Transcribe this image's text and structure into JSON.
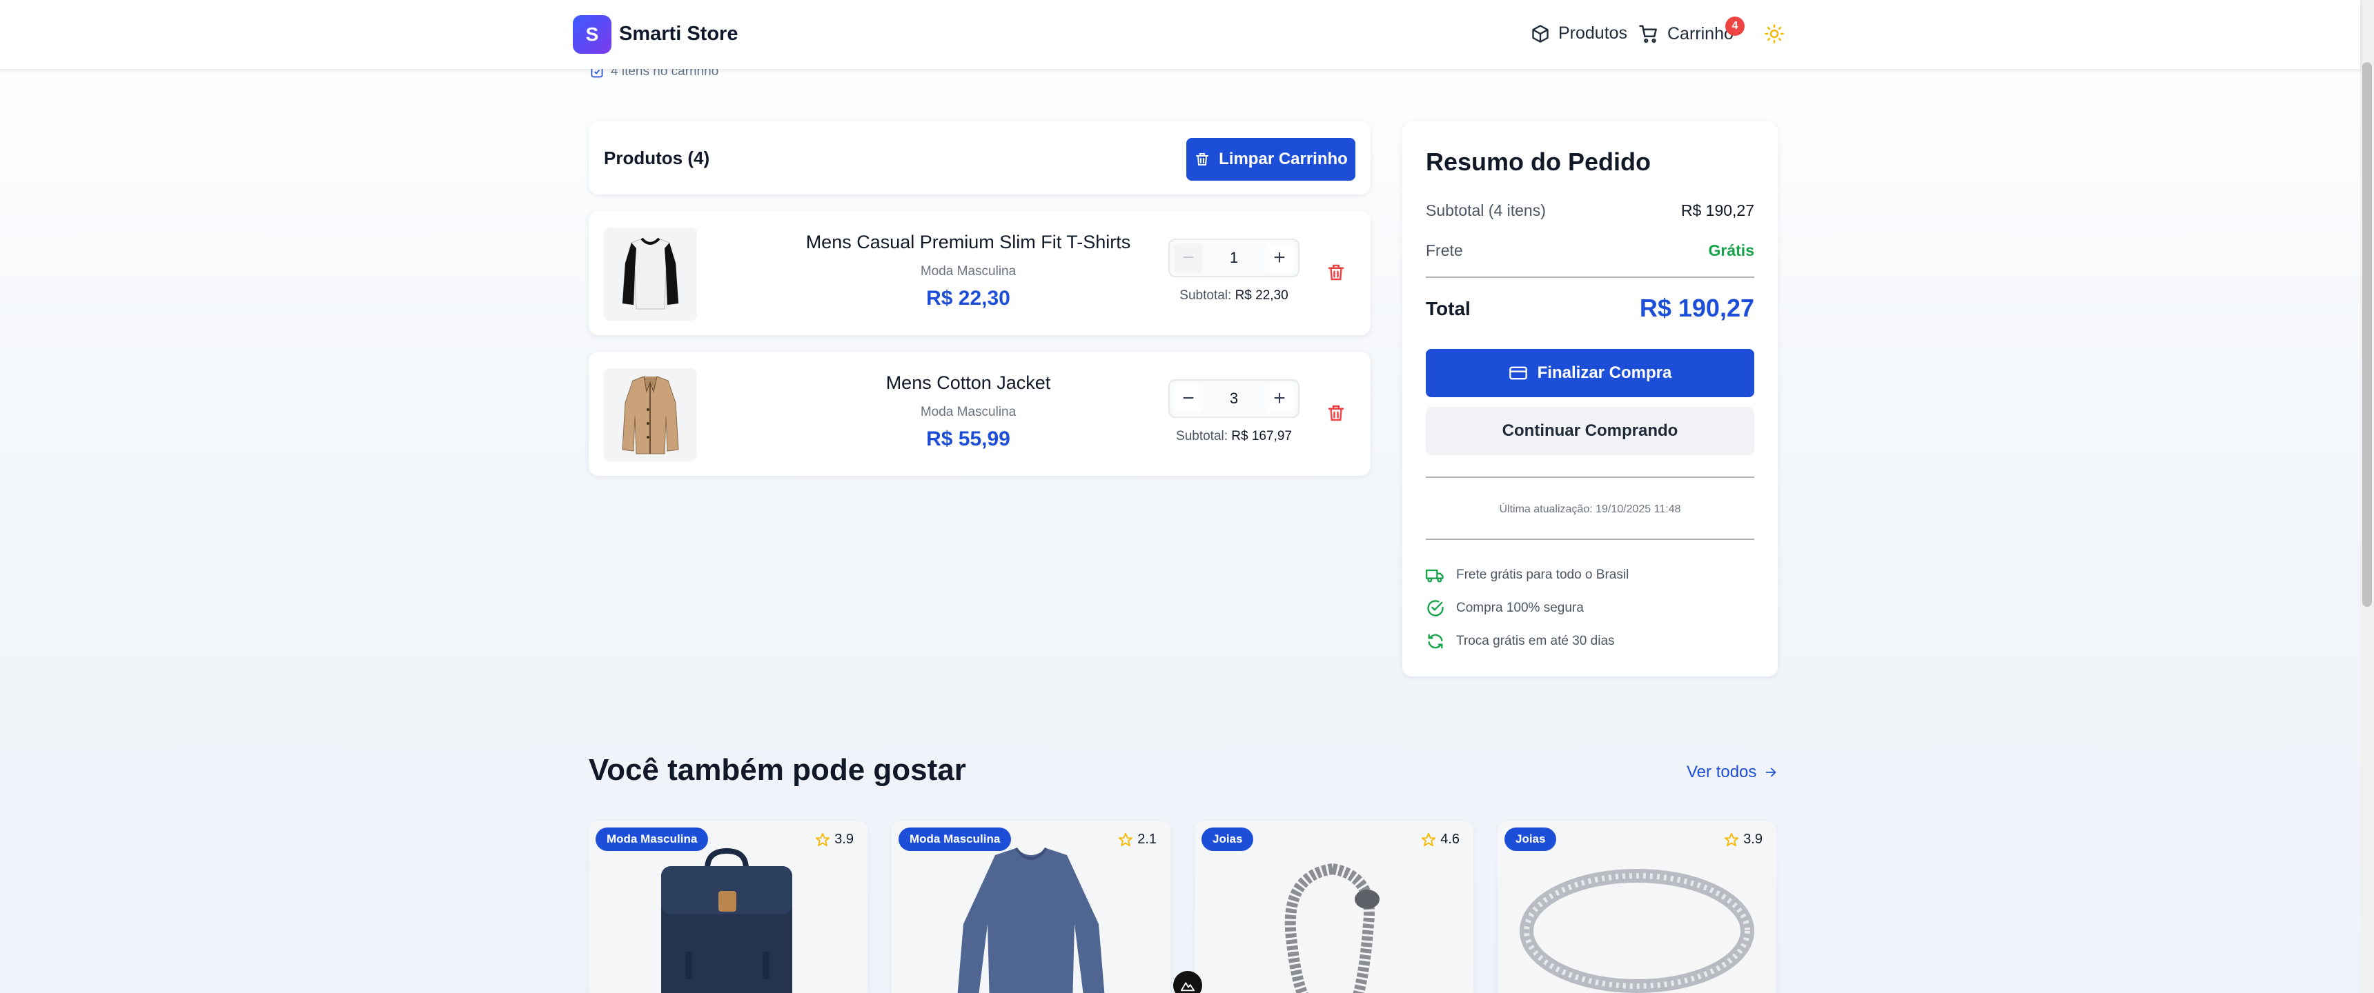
{
  "header": {
    "logo_letter": "S",
    "brand": "Smarti Store",
    "nav_products": "Produtos",
    "nav_cart": "Carrinho",
    "cart_count": "4"
  },
  "cart_info": "4 itens no carrinho",
  "products_panel": {
    "title": "Produtos (4)",
    "clear_label": "Limpar Carrinho"
  },
  "items": [
    {
      "name": "Mens Casual Premium Slim Fit T-Shirts",
      "category": "Moda Masculina",
      "price": "R$ 22,30",
      "qty": "1",
      "subtotal_label": "Subtotal:",
      "subtotal": "R$ 22,30"
    },
    {
      "name": "Mens Cotton Jacket",
      "category": "Moda Masculina",
      "price": "R$ 55,99",
      "qty": "3",
      "subtotal_label": "Subtotal:",
      "subtotal": "R$ 167,97"
    }
  ],
  "summary": {
    "title": "Resumo do Pedido",
    "subtotal_label": "Subtotal (4 itens)",
    "subtotal_value": "R$ 190,27",
    "shipping_label": "Frete",
    "shipping_value": "Grátis",
    "total_label": "Total",
    "total_value": "R$ 190,27",
    "checkout_label": "Finalizar Compra",
    "continue_label": "Continuar Comprando",
    "last_update": "Última atualização: 19/10/2025 11:48",
    "features": [
      "Frete grátis para todo o Brasil",
      "Compra 100% segura",
      "Troca grátis em até 30 dias"
    ]
  },
  "recommendations": {
    "title": "Você também pode gostar",
    "see_all": "Ver todos",
    "products": [
      {
        "category": "Moda Masculina",
        "rating": "3.9",
        "icon": "backpack"
      },
      {
        "category": "Moda Masculina",
        "rating": "2.1",
        "icon": "long-sleeve-shirt"
      },
      {
        "category": "Joias",
        "rating": "4.6",
        "icon": "dragon-bracelet"
      },
      {
        "category": "Joias",
        "rating": "3.9",
        "icon": "silver-ring"
      }
    ]
  },
  "colors": {
    "primary": "#1d4ed8",
    "success": "#16a34a",
    "danger": "#ef4444",
    "star": "#f5b800"
  }
}
